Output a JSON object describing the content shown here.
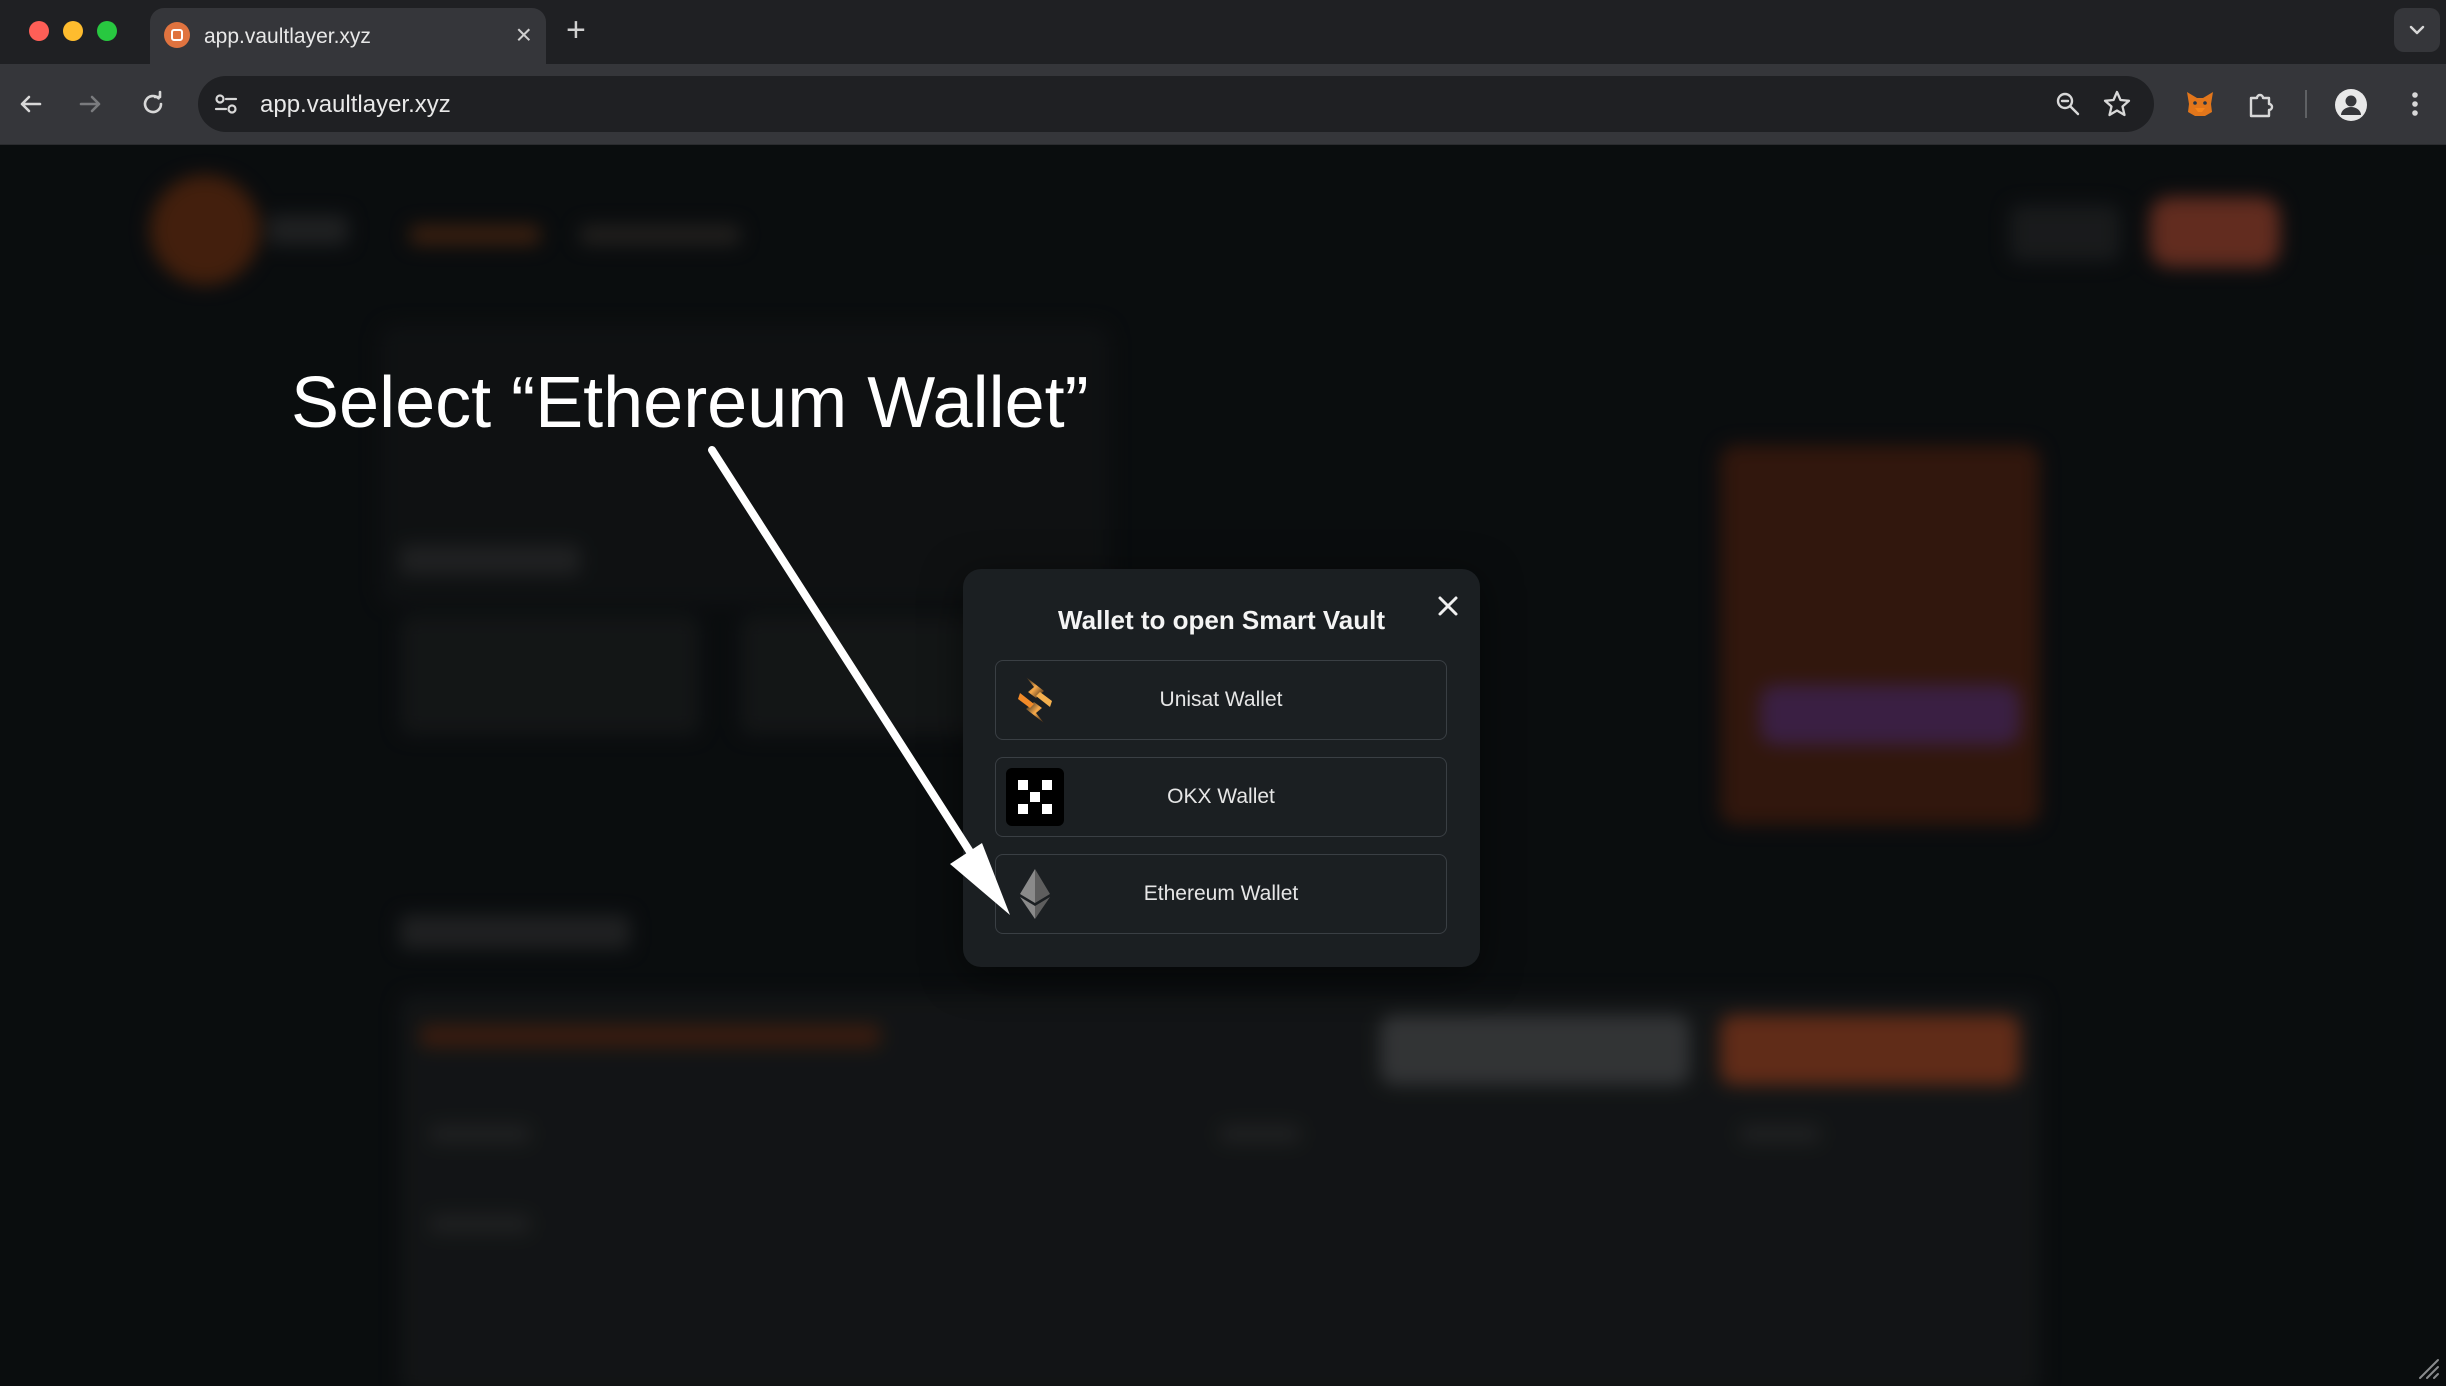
{
  "browser": {
    "tab_title": "app.vaultlayer.xyz",
    "tab_close": "×",
    "new_tab": "+",
    "url": "app.vaultlayer.xyz"
  },
  "modal": {
    "title": "Wallet to open Smart Vault",
    "options": [
      {
        "label": "Unisat Wallet",
        "icon": "unisat-icon"
      },
      {
        "label": "OKX Wallet",
        "icon": "okx-icon"
      },
      {
        "label": "Ethereum Wallet",
        "icon": "ethereum-icon"
      }
    ]
  },
  "annotation": {
    "text": "Select “Ethereum Wallet”"
  },
  "colors": {
    "accent_orange": "#e0733f",
    "modal_bg": "#1b1f22",
    "page_bg": "#13181b"
  }
}
